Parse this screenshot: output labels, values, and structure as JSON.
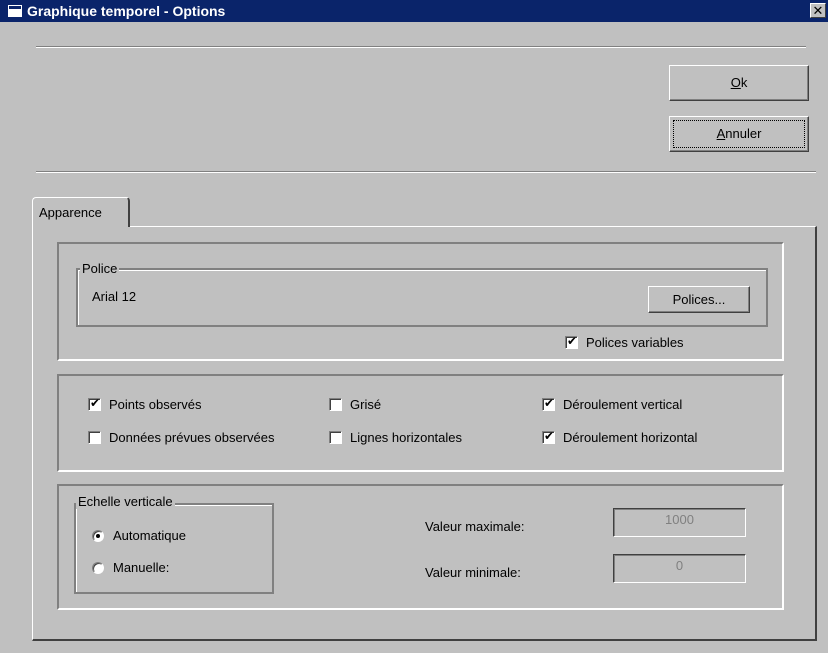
{
  "window": {
    "title": "Graphique temporel - Options",
    "close_glyph": "✕"
  },
  "buttons": {
    "ok": {
      "accel": "O",
      "rest": "k"
    },
    "cancel": {
      "accel": "A",
      "rest": "nnuler"
    }
  },
  "tabs": [
    {
      "label": "Apparence"
    }
  ],
  "font_group": {
    "legend": "Police",
    "current_font": "Arial 12",
    "fonts_button": "Polices...",
    "variable_fonts": {
      "label": "Polices variables",
      "checked": true
    }
  },
  "options": [
    {
      "label": "Points observés",
      "checked": true
    },
    {
      "label": "Données prévues observées",
      "checked": false
    },
    {
      "label": "Grisé",
      "checked": false
    },
    {
      "label": "Lignes horizontales",
      "checked": false
    },
    {
      "label": "Déroulement vertical",
      "checked": true
    },
    {
      "label": "Déroulement horizontal",
      "checked": true
    }
  ],
  "vertical_scale": {
    "legend": "Echelle verticale",
    "automatic": {
      "label": "Automatique",
      "selected": true
    },
    "manual": {
      "label": "Manuelle:",
      "selected": false
    },
    "max_label": "Valeur maximale:",
    "max_value": "1000",
    "min_label": "Valeur minimale:",
    "min_value": "0"
  }
}
